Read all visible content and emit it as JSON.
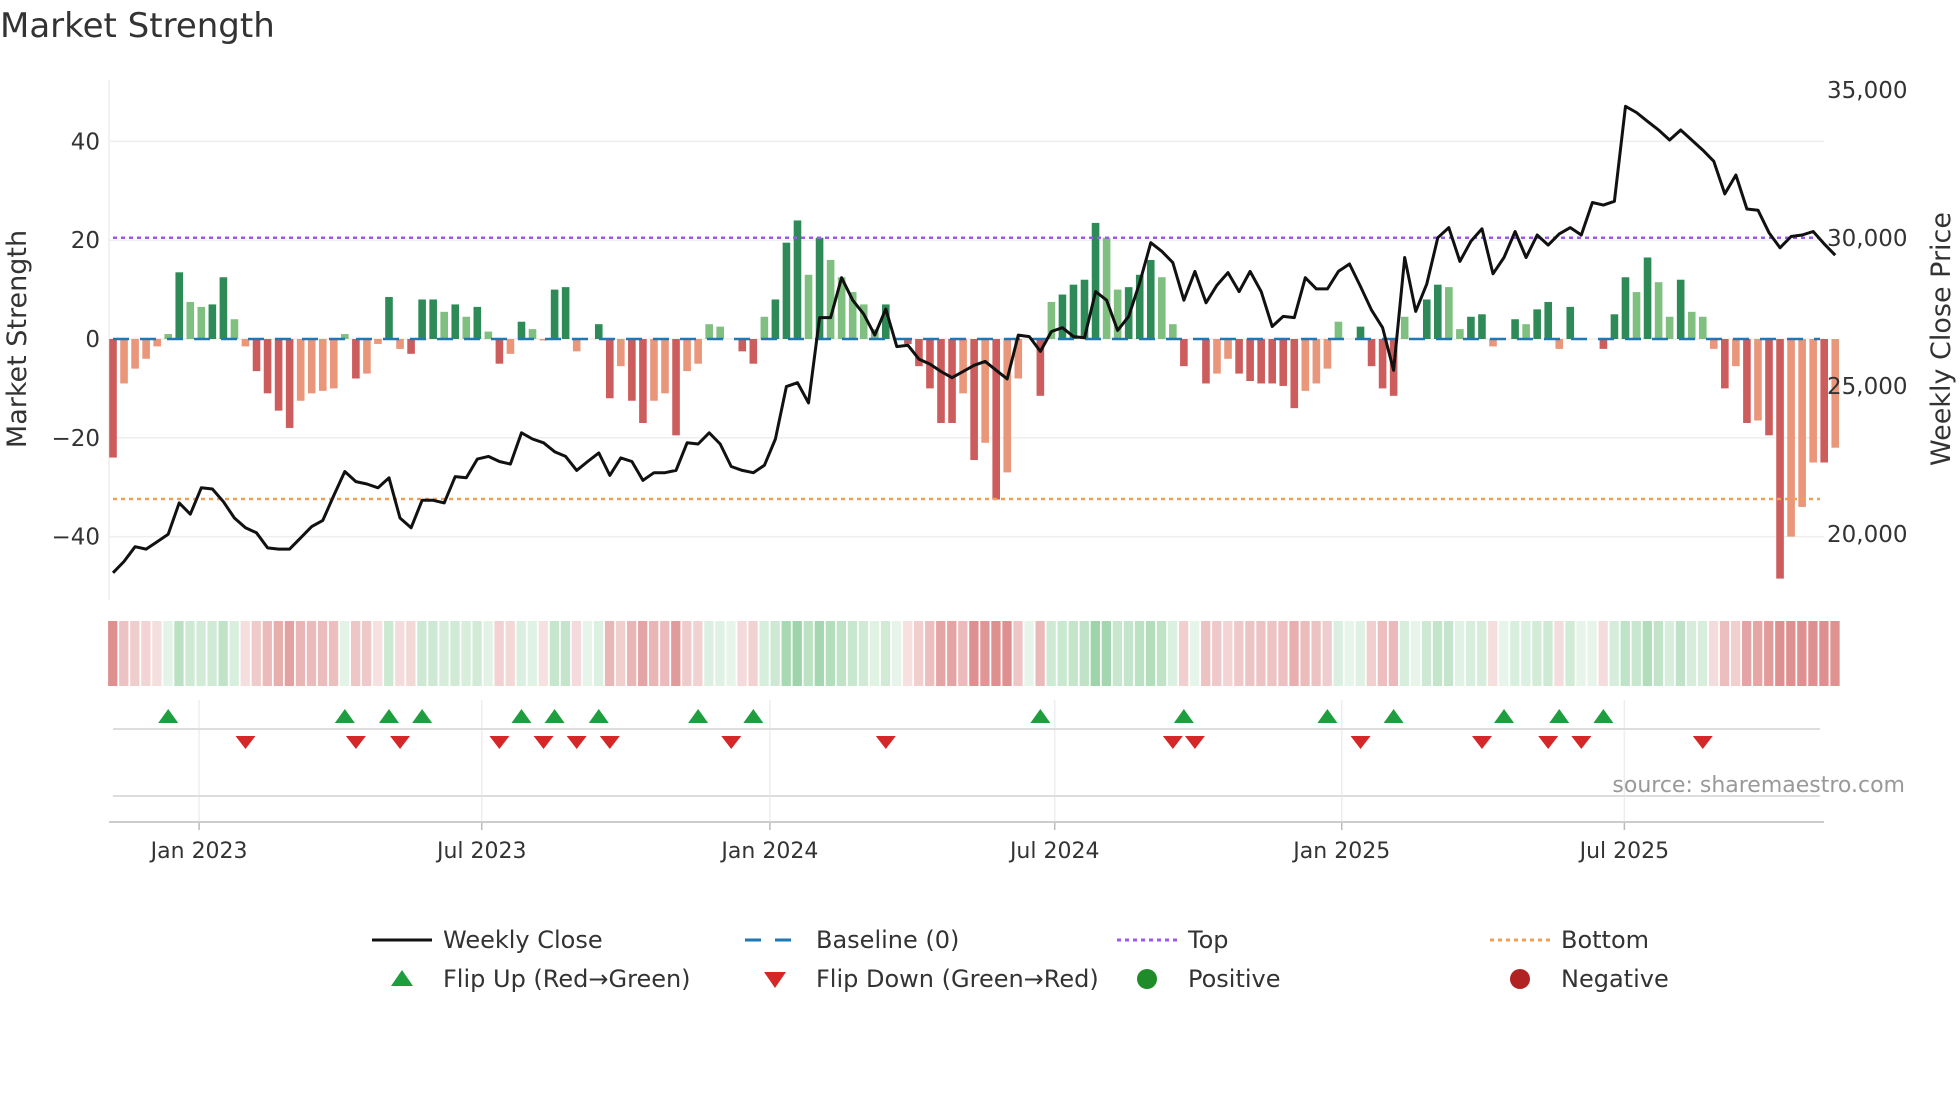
{
  "title": "Market Strength",
  "source": "source: sharemaestro.com",
  "chart_data": {
    "type": "bar",
    "title": "Market Strength",
    "ylabel": "Market Strength",
    "y2label": "Weekly Close Price",
    "ylim": [
      -52,
      52
    ],
    "y2lim": [
      17900,
      35600
    ],
    "yticks": [
      {
        "v": 40,
        "label": "40"
      },
      {
        "v": 20,
        "label": "20"
      },
      {
        "v": 0,
        "label": "0"
      },
      {
        "v": -20,
        "label": "−20"
      },
      {
        "v": -40,
        "label": "−40"
      }
    ],
    "y2ticks": [
      {
        "v": 35000,
        "label": "35,000"
      },
      {
        "v": 30000,
        "label": "30,000"
      },
      {
        "v": 25000,
        "label": "25,000"
      },
      {
        "v": 20000,
        "label": "20,000"
      }
    ],
    "xticks": [
      {
        "week": 7.8,
        "label": "Jan 2023"
      },
      {
        "week": 33.4,
        "label": "Jul 2023"
      },
      {
        "week": 59.5,
        "label": "Jan 2024"
      },
      {
        "week": 85.3,
        "label": "Jul 2024"
      },
      {
        "week": 111.3,
        "label": "Jan 2025"
      },
      {
        "week": 136.9,
        "label": "Jul 2025"
      }
    ],
    "top_level": 20.5,
    "bottom_level": -32.4,
    "strength": [
      -24,
      -9,
      -6,
      -4,
      -1.5,
      1,
      13.5,
      7.5,
      6.5,
      7,
      12.5,
      4,
      -1.5,
      -6.5,
      -11,
      -14.5,
      -18,
      -12.5,
      -11,
      -10.5,
      -10,
      1,
      -8,
      -7,
      -1,
      8.5,
      -2,
      -3,
      8,
      8,
      5.5,
      7,
      4.5,
      6.5,
      1.5,
      -5,
      -3,
      3.5,
      2,
      -0.3,
      10,
      10.5,
      -2.5,
      0,
      3,
      -12,
      -5.5,
      -12.5,
      -17,
      -12.5,
      -11,
      -19.5,
      -6.5,
      -5,
      3,
      2.5,
      0,
      -2.5,
      -5,
      4.5,
      8,
      19.5,
      24,
      13,
      20.5,
      16,
      12.5,
      9.5,
      7,
      2,
      7,
      0,
      -1,
      -5.5,
      -10,
      -17,
      -17,
      -11,
      -24.5,
      -21,
      -32.5,
      -27,
      -8,
      0,
      -11.5,
      7.5,
      9,
      11,
      12,
      23.5,
      20.5,
      10,
      10.5,
      13,
      16,
      12.5,
      3,
      -5.5,
      0,
      -9,
      -7,
      -4,
      -7,
      -8.5,
      -9,
      -9,
      -9.5,
      -14,
      -10.5,
      -9,
      -6,
      3.5,
      0,
      2.5,
      -5.5,
      -10,
      -11.5,
      4.5,
      0,
      8,
      11,
      10.5,
      2,
      4.5,
      5,
      -1.5,
      0,
      4,
      3,
      6,
      7.5,
      -2,
      6.5,
      0,
      0,
      -2,
      5,
      12.5,
      9.5,
      16.5,
      11.5,
      4.5,
      12,
      5.5,
      4.5,
      -2,
      -10,
      -5.5,
      -17,
      -16.5,
      -19.5,
      -48.5,
      -40,
      -34,
      -25,
      -25,
      -22
    ],
    "weekly_close": [
      18690,
      19070,
      19570,
      19490,
      19740,
      19990,
      21050,
      20670,
      21560,
      21520,
      21090,
      20540,
      20210,
      20040,
      19530,
      19490,
      19490,
      19870,
      20250,
      20460,
      21300,
      22110,
      21770,
      21690,
      21560,
      21900,
      20540,
      20210,
      21140,
      21140,
      21050,
      21940,
      21900,
      22530,
      22620,
      22450,
      22360,
      23420,
      23210,
      23080,
      22780,
      22620,
      22150,
      22450,
      22740,
      21980,
      22570,
      22450,
      21810,
      22070,
      22070,
      22150,
      23080,
      23040,
      23420,
      23040,
      22280,
      22150,
      22070,
      22320,
      23210,
      24980,
      25110,
      24430,
      27310,
      27310,
      28660,
      27900,
      27430,
      26720,
      27600,
      26330,
      26380,
      25910,
      25740,
      25490,
      25280,
      25490,
      25700,
      25830,
      25530,
      25240,
      26720,
      26670,
      26170,
      26840,
      26970,
      26670,
      26630,
      28190,
      27900,
      26880,
      27350,
      28490,
      29840,
      29550,
      29170,
      27900,
      28870,
      27810,
      28410,
      28830,
      28190,
      28870,
      28190,
      27010,
      27350,
      27310,
      28660,
      28280,
      28280,
      28870,
      29120,
      28360,
      27560,
      26970,
      25530,
      29340,
      27520,
      28450,
      30010,
      30350,
      29210,
      29890,
      30310,
      28790,
      29340,
      30220,
      29340,
      30100,
      29760,
      30140,
      30350,
      30100,
      31200,
      31110,
      31240,
      34450,
      34240,
      33940,
      33650,
      33310,
      33650,
      33310,
      32970,
      32590,
      31490,
      32130,
      30980,
      30940,
      30180,
      29670,
      30050,
      30100,
      30220,
      29800,
      29420
    ],
    "flip_up_weeks": [
      5,
      21,
      25,
      28,
      37,
      40,
      44,
      53,
      58,
      84,
      97,
      110,
      116,
      126,
      131,
      135
    ],
    "flip_down_weeks": [
      12,
      22,
      26,
      35,
      39,
      42,
      45,
      56,
      70,
      96,
      98,
      113,
      124,
      130,
      133,
      144
    ],
    "legend": [
      {
        "label": "Weekly Close",
        "kind": "line"
      },
      {
        "label": "Baseline (0)",
        "kind": "dash"
      },
      {
        "label": "Top",
        "kind": "dot-purple"
      },
      {
        "label": "Bottom",
        "kind": "dot-orange"
      },
      {
        "label": "Flip Up (Red→Green)",
        "kind": "tri-up"
      },
      {
        "label": "Flip Down (Green→Red)",
        "kind": "tri-down"
      },
      {
        "label": "Positive",
        "kind": "circle-green"
      },
      {
        "label": "Negative",
        "kind": "circle-red"
      }
    ],
    "legend_position": "bottom"
  },
  "colors": {
    "pos_strong": "#2e8b57",
    "pos_weak": "#7fbf7f",
    "neg_strong": "#cd5c5c",
    "neg_weak": "#e9967a",
    "baseline": "#1f77b4",
    "top": "#9b59f0",
    "bottom": "#f0a050",
    "flip_up": "#1e9e3e",
    "flip_down": "#d62728",
    "positive": "#1e8c28",
    "negative": "#b22222",
    "line": "#111111"
  }
}
